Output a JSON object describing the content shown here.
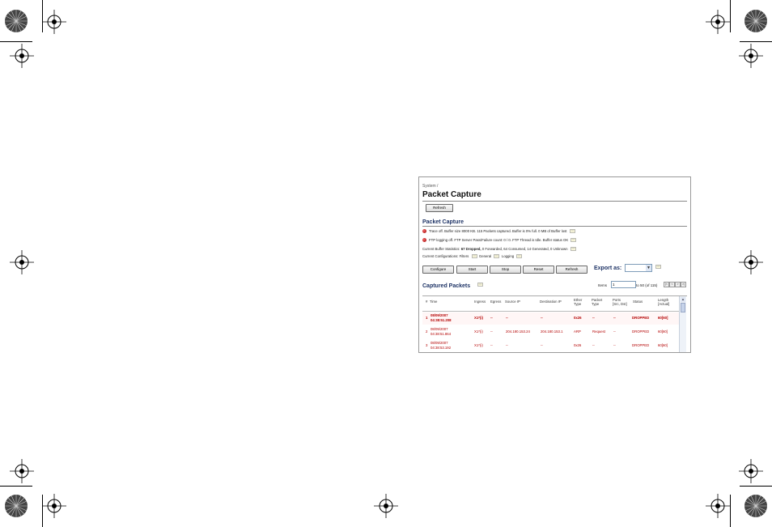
{
  "breadcrumb": "System /",
  "page_title": "Packet Capture",
  "top_refresh_label": "Refresh",
  "section_title": "Packet Capture",
  "status_lines": {
    "trace": "Trace off.   Buffer size 8000 KB.  115 Packets captured.  Buffer is 0% full.  0 MB of Buffer lost",
    "ftp": "FTP logging off.   FTP Server Pass/Failure count: 0 / 0.  FTP Thread is Idle.  Buffer status OK",
    "buffer_stats_prefix": "Current Buffer Statistics:",
    "buffer_stats_bold": "67 Dropped,",
    "buffer_stats_rest": " 0 Forwarded, 64 Consumed, 14 Generated, 0 Unknown",
    "config_prefix": "Current Configurations: Filters",
    "config_general": "General",
    "config_logging": "Logging"
  },
  "actions": {
    "configure": "Configure",
    "start": "Start",
    "stop": "Stop",
    "reset": "Reset",
    "refresh": "Refresh"
  },
  "export_label": "Export as:",
  "captured_title": "Captured Packets",
  "pagination": {
    "items_label": "Items",
    "items_value": "1",
    "range_text": "to 50 (of 115)",
    "first": "|<",
    "prev": "<",
    "next": ">",
    "last": ">|"
  },
  "table": {
    "headers": {
      "num": "#",
      "time": "Time",
      "ingress": "Ingress",
      "egress": "Egress",
      "source_ip": "Source IP",
      "dest_ip": "Destination IP",
      "ether_type_1": "Ether",
      "ether_type_2": "Type",
      "packet_type_1": "Packet",
      "packet_type_2": "Type",
      "ports_1": "Ports",
      "ports_2": "[Src, Dst]",
      "status": "Status",
      "length_1": "Length",
      "length_2": "[Actual]"
    },
    "rows": [
      {
        "num": "1",
        "date": "08/09/2007",
        "time": "04:38:51.208",
        "ingress": "X1*(i)",
        "egress": "--",
        "src": "--",
        "dst": "--",
        "ether": "0x26",
        "ptype": "--",
        "ports": "--",
        "status": "DROPPED",
        "length": "60[60]"
      },
      {
        "num": "2",
        "date": "08/09/2007",
        "time": "04:38:51.864",
        "ingress": "X1*(i)",
        "egress": "--",
        "src": "204.180.153.24",
        "dst": "204.180.153.1",
        "ether": "ARP",
        "ptype": "Request",
        "ports": "--",
        "status": "DROPPED",
        "length": "60[60]"
      },
      {
        "num": "3",
        "date": "08/09/2007",
        "time": "04:38:53.192",
        "ingress": "X1*(i)",
        "egress": "--",
        "src": "--",
        "dst": "--",
        "ether": "0x26",
        "ptype": "--",
        "ports": "--",
        "status": "DROPPED",
        "length": "60[60]"
      }
    ]
  },
  "colors": {
    "accent": "#1f3466",
    "dropped": "#b40000",
    "mark": "#000000"
  }
}
